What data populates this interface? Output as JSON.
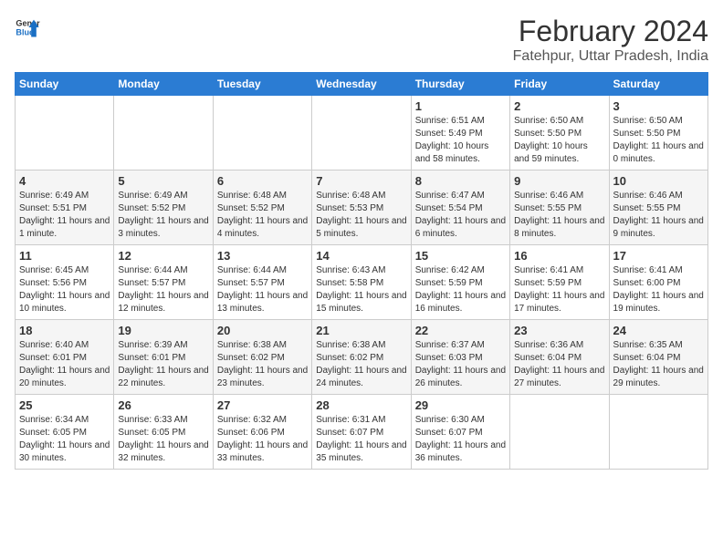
{
  "header": {
    "logo_line1": "General",
    "logo_line2": "Blue",
    "main_title": "February 2024",
    "subtitle": "Fatehpur, Uttar Pradesh, India"
  },
  "weekdays": [
    "Sunday",
    "Monday",
    "Tuesday",
    "Wednesday",
    "Thursday",
    "Friday",
    "Saturday"
  ],
  "weeks": [
    [
      {
        "num": "",
        "empty": true
      },
      {
        "num": "",
        "empty": true
      },
      {
        "num": "",
        "empty": true
      },
      {
        "num": "",
        "empty": true
      },
      {
        "num": "1",
        "sunrise": "6:51 AM",
        "sunset": "5:49 PM",
        "daylight": "10 hours and 58 minutes."
      },
      {
        "num": "2",
        "sunrise": "6:50 AM",
        "sunset": "5:50 PM",
        "daylight": "10 hours and 59 minutes."
      },
      {
        "num": "3",
        "sunrise": "6:50 AM",
        "sunset": "5:50 PM",
        "daylight": "11 hours and 0 minutes."
      }
    ],
    [
      {
        "num": "4",
        "sunrise": "6:49 AM",
        "sunset": "5:51 PM",
        "daylight": "11 hours and 1 minute."
      },
      {
        "num": "5",
        "sunrise": "6:49 AM",
        "sunset": "5:52 PM",
        "daylight": "11 hours and 3 minutes."
      },
      {
        "num": "6",
        "sunrise": "6:48 AM",
        "sunset": "5:52 PM",
        "daylight": "11 hours and 4 minutes."
      },
      {
        "num": "7",
        "sunrise": "6:48 AM",
        "sunset": "5:53 PM",
        "daylight": "11 hours and 5 minutes."
      },
      {
        "num": "8",
        "sunrise": "6:47 AM",
        "sunset": "5:54 PM",
        "daylight": "11 hours and 6 minutes."
      },
      {
        "num": "9",
        "sunrise": "6:46 AM",
        "sunset": "5:55 PM",
        "daylight": "11 hours and 8 minutes."
      },
      {
        "num": "10",
        "sunrise": "6:46 AM",
        "sunset": "5:55 PM",
        "daylight": "11 hours and 9 minutes."
      }
    ],
    [
      {
        "num": "11",
        "sunrise": "6:45 AM",
        "sunset": "5:56 PM",
        "daylight": "11 hours and 10 minutes."
      },
      {
        "num": "12",
        "sunrise": "6:44 AM",
        "sunset": "5:57 PM",
        "daylight": "11 hours and 12 minutes."
      },
      {
        "num": "13",
        "sunrise": "6:44 AM",
        "sunset": "5:57 PM",
        "daylight": "11 hours and 13 minutes."
      },
      {
        "num": "14",
        "sunrise": "6:43 AM",
        "sunset": "5:58 PM",
        "daylight": "11 hours and 15 minutes."
      },
      {
        "num": "15",
        "sunrise": "6:42 AM",
        "sunset": "5:59 PM",
        "daylight": "11 hours and 16 minutes."
      },
      {
        "num": "16",
        "sunrise": "6:41 AM",
        "sunset": "5:59 PM",
        "daylight": "11 hours and 17 minutes."
      },
      {
        "num": "17",
        "sunrise": "6:41 AM",
        "sunset": "6:00 PM",
        "daylight": "11 hours and 19 minutes."
      }
    ],
    [
      {
        "num": "18",
        "sunrise": "6:40 AM",
        "sunset": "6:01 PM",
        "daylight": "11 hours and 20 minutes."
      },
      {
        "num": "19",
        "sunrise": "6:39 AM",
        "sunset": "6:01 PM",
        "daylight": "11 hours and 22 minutes."
      },
      {
        "num": "20",
        "sunrise": "6:38 AM",
        "sunset": "6:02 PM",
        "daylight": "11 hours and 23 minutes."
      },
      {
        "num": "21",
        "sunrise": "6:38 AM",
        "sunset": "6:02 PM",
        "daylight": "11 hours and 24 minutes."
      },
      {
        "num": "22",
        "sunrise": "6:37 AM",
        "sunset": "6:03 PM",
        "daylight": "11 hours and 26 minutes."
      },
      {
        "num": "23",
        "sunrise": "6:36 AM",
        "sunset": "6:04 PM",
        "daylight": "11 hours and 27 minutes."
      },
      {
        "num": "24",
        "sunrise": "6:35 AM",
        "sunset": "6:04 PM",
        "daylight": "11 hours and 29 minutes."
      }
    ],
    [
      {
        "num": "25",
        "sunrise": "6:34 AM",
        "sunset": "6:05 PM",
        "daylight": "11 hours and 30 minutes."
      },
      {
        "num": "26",
        "sunrise": "6:33 AM",
        "sunset": "6:05 PM",
        "daylight": "11 hours and 32 minutes."
      },
      {
        "num": "27",
        "sunrise": "6:32 AM",
        "sunset": "6:06 PM",
        "daylight": "11 hours and 33 minutes."
      },
      {
        "num": "28",
        "sunrise": "6:31 AM",
        "sunset": "6:07 PM",
        "daylight": "11 hours and 35 minutes."
      },
      {
        "num": "29",
        "sunrise": "6:30 AM",
        "sunset": "6:07 PM",
        "daylight": "11 hours and 36 minutes."
      },
      {
        "num": "",
        "empty": true
      },
      {
        "num": "",
        "empty": true
      }
    ]
  ]
}
